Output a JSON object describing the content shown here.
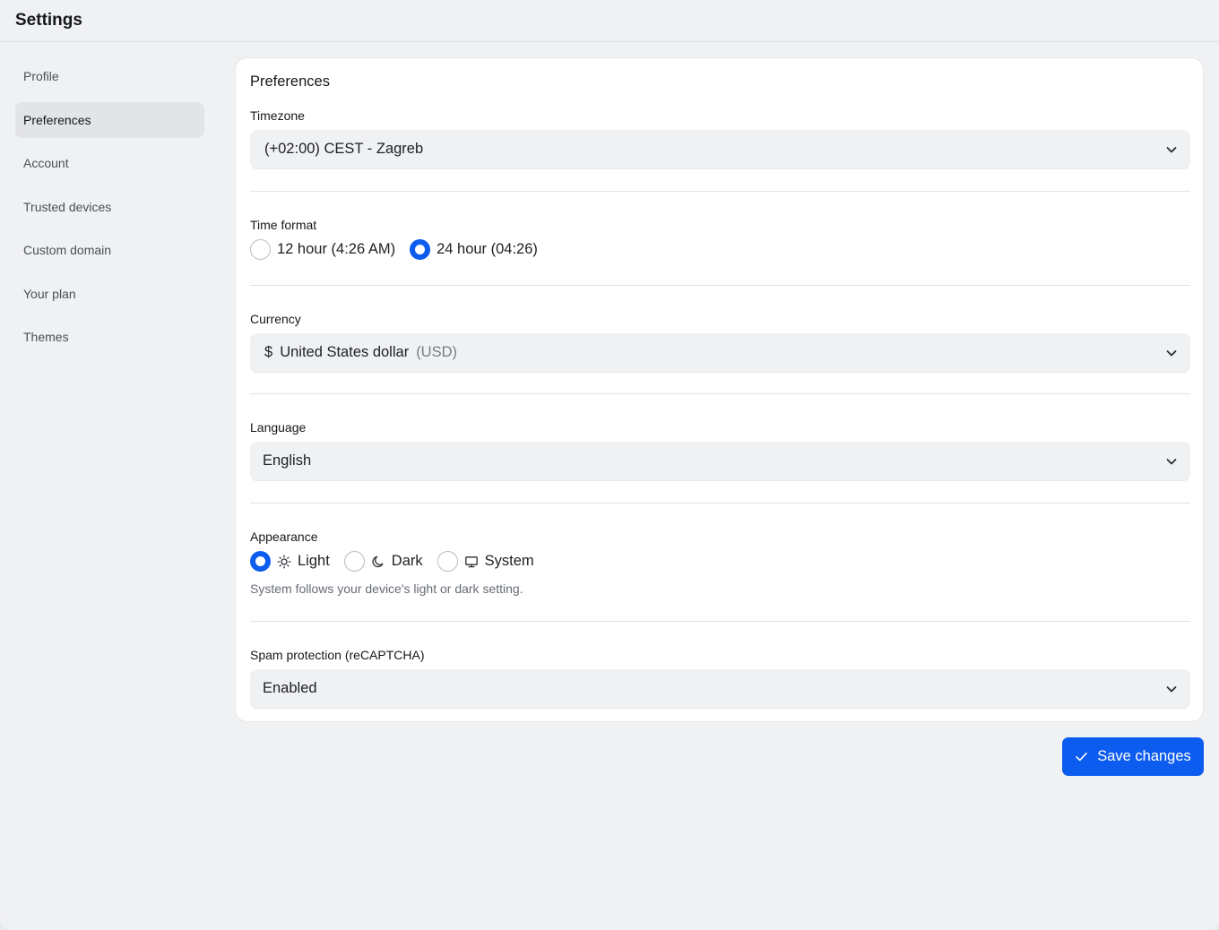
{
  "header": {
    "title": "Settings"
  },
  "sidebar": {
    "items": [
      {
        "label": "Profile",
        "active": false
      },
      {
        "label": "Preferences",
        "active": true
      },
      {
        "label": "Account",
        "active": false
      },
      {
        "label": "Trusted devices",
        "active": false
      },
      {
        "label": "Custom domain",
        "active": false
      },
      {
        "label": "Your plan",
        "active": false
      },
      {
        "label": "Themes",
        "active": false
      }
    ]
  },
  "preferences": {
    "title": "Preferences",
    "timezone": {
      "label": "Timezone",
      "value": "(+02:00) CEST - Zagreb"
    },
    "time_format": {
      "label": "Time format",
      "options": [
        {
          "label": "12 hour (4:26 AM)",
          "selected": false
        },
        {
          "label": "24 hour (04:26)",
          "selected": true
        }
      ]
    },
    "currency": {
      "label": "Currency",
      "symbol": "$",
      "name": "United States dollar",
      "code": "(USD)"
    },
    "language": {
      "label": "Language",
      "value": "English"
    },
    "appearance": {
      "label": "Appearance",
      "options": [
        {
          "label": "Light",
          "icon": "sun-icon",
          "selected": true
        },
        {
          "label": "Dark",
          "icon": "moon-icon",
          "selected": false
        },
        {
          "label": "System",
          "icon": "monitor-icon",
          "selected": false
        }
      ],
      "hint": "System follows your device's light or dark setting."
    },
    "spam_protection": {
      "label": "Spam protection (reCAPTCHA)",
      "value": "Enabled"
    }
  },
  "actions": {
    "save_label": "Save changes"
  },
  "colors": {
    "accent": "#0d5cf0",
    "background": "#f0f1f3",
    "card": "#ffffff"
  }
}
